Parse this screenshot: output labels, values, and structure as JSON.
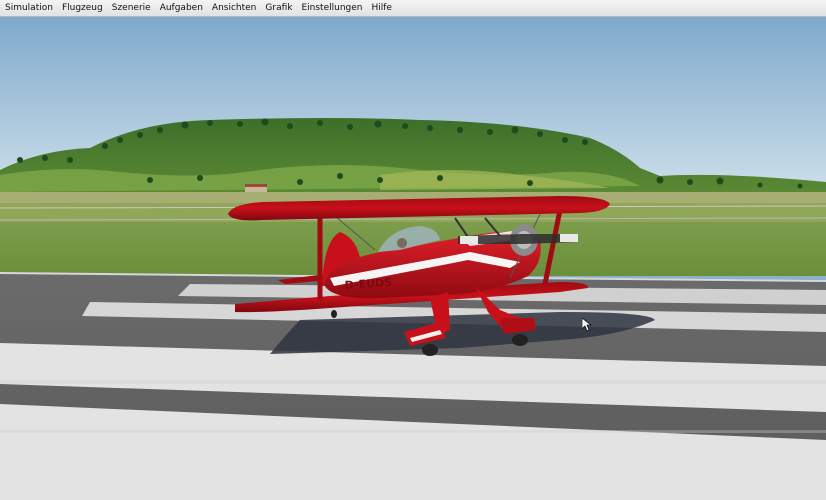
{
  "menubar": {
    "items": [
      {
        "label": "Simulation"
      },
      {
        "label": "Flugzeug"
      },
      {
        "label": "Szenerie"
      },
      {
        "label": "Aufgaben"
      },
      {
        "label": "Ansichten"
      },
      {
        "label": "Grafik"
      },
      {
        "label": "Einstellungen"
      },
      {
        "label": "Hilfe"
      }
    ]
  },
  "aircraft": {
    "registration": "D-EUDS"
  },
  "colors": {
    "menubar_bg": "#e9e9e9",
    "sky": "#8fb6d6",
    "grass": "#6f9640",
    "runway": "#6c6c6c",
    "marking": "#e6e6e6",
    "aircraft_red": "#c8101a"
  }
}
